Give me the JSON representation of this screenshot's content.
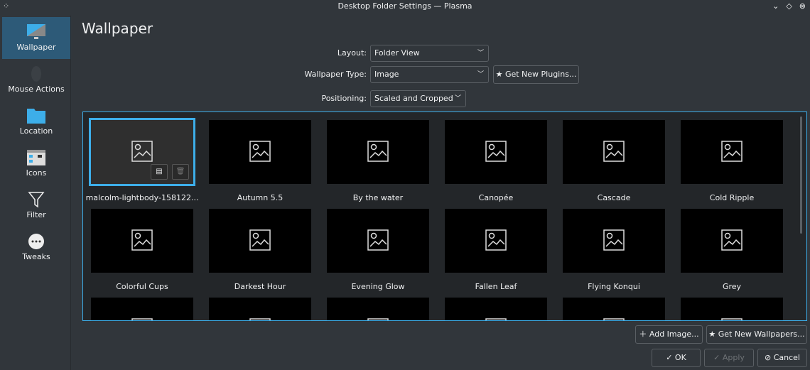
{
  "window": {
    "title": "Desktop Folder Settings — Plasma"
  },
  "sidebar": {
    "items": [
      {
        "label": "Wallpaper",
        "icon": "monitor-icon",
        "selected": true
      },
      {
        "label": "Mouse Actions",
        "icon": "mouse-icon"
      },
      {
        "label": "Location",
        "icon": "folder-icon"
      },
      {
        "label": "Icons",
        "icon": "icons-icon"
      },
      {
        "label": "Filter",
        "icon": "filter-icon"
      },
      {
        "label": "Tweaks",
        "icon": "tweaks-icon"
      }
    ]
  },
  "page": {
    "title": "Wallpaper"
  },
  "form": {
    "layout_label": "Layout:",
    "layout_value": "Folder View",
    "type_label": "Wallpaper Type:",
    "type_value": "Image",
    "get_plugins": "Get New Plugins...",
    "positioning_label": "Positioning:",
    "positioning_value": "Scaled and Cropped"
  },
  "wallpapers": [
    "malcolm-lightbody-158122...",
    "Autumn 5.5",
    "By the water",
    "Canopée",
    "Cascade",
    "Cold Ripple",
    "Colorful Cups",
    "Darkest Hour",
    "Evening Glow",
    "Fallen Leaf",
    "Flying Konqui",
    "Grey",
    "",
    "",
    "",
    "",
    "",
    ""
  ],
  "buttons": {
    "add_image": "Add Image...",
    "get_wallpapers": "Get New Wallpapers...",
    "ok": "OK",
    "apply": "Apply",
    "cancel": "Cancel"
  },
  "colors": {
    "accent": "#3daee9",
    "background": "#31363b",
    "selected_sidebar": "#2d5a78"
  }
}
